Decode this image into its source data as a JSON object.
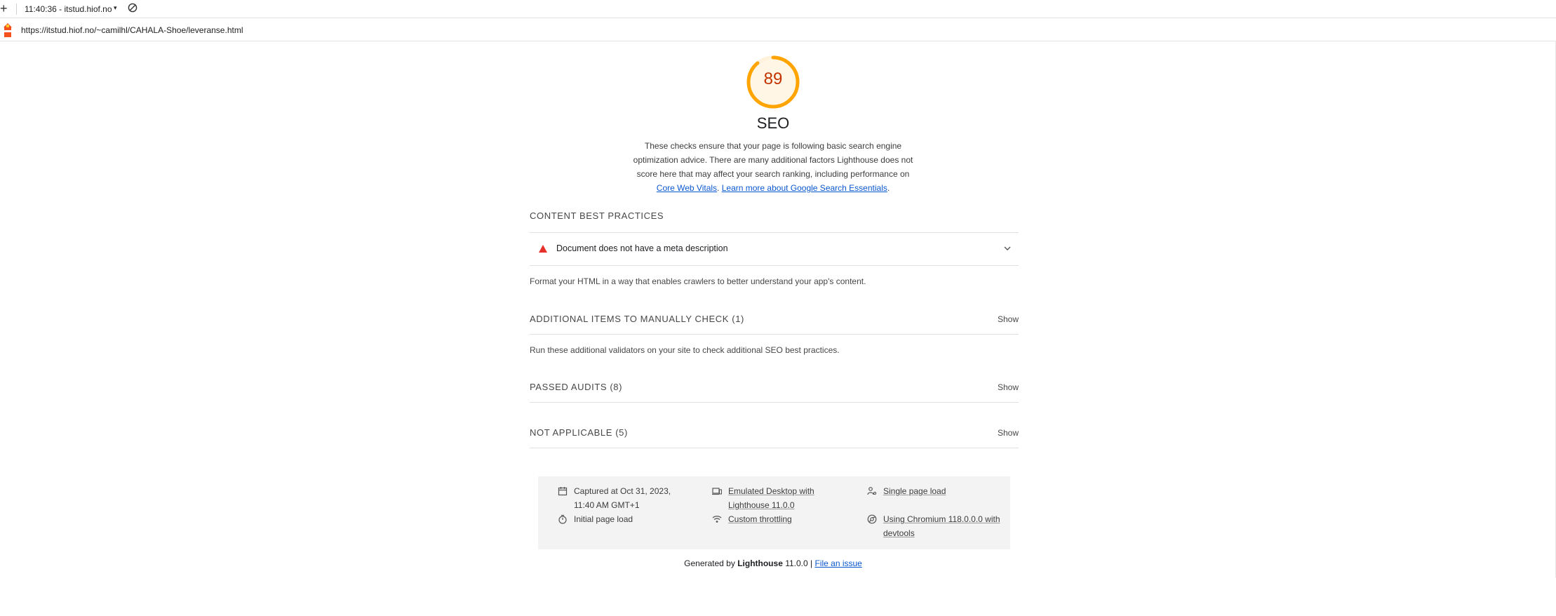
{
  "topbar": {
    "new_tab_symbol": "+",
    "session_label": "11:40:36 - itstud.hiof.no",
    "caret": "▾"
  },
  "address": {
    "url": "https://itstud.hiof.no/~camilhl/CAHALA-Shoe/leveranse.html"
  },
  "score": {
    "value": "89",
    "fraction": 0.89,
    "color": "#ffa400",
    "text_color": "#c33300"
  },
  "category": {
    "title": "SEO",
    "description_line1": "These checks ensure that your page is following basic search engine",
    "description_line2": "optimization advice. There are many additional factors Lighthouse does not",
    "description_line3": "score here that may affect your search ranking, including performance on",
    "link1": "Core Web Vitals",
    "sep": ". ",
    "link2": "Learn more about Google Search Essentials",
    "end": "."
  },
  "sections": {
    "content": {
      "title": "CONTENT BEST PRACTICES",
      "audit": "Document does not have a meta description",
      "description": "Format your HTML in a way that enables crawlers to better understand your app's content."
    },
    "manual": {
      "title": "ADDITIONAL ITEMS TO MANUALLY CHECK",
      "count": "(1)",
      "show": "Show",
      "description": "Run these additional validators on your site to check additional SEO best practices."
    },
    "passed": {
      "title": "PASSED AUDITS",
      "count": "(8)",
      "show": "Show"
    },
    "not_applicable": {
      "title": "NOT APPLICABLE",
      "count": "(5)",
      "show": "Show"
    }
  },
  "meta": {
    "captured_line1": "Captured at Oct 31, 2023,",
    "captured_line2": "11:40 AM GMT+1",
    "emulated_line1": "Emulated Desktop with",
    "emulated_line2": "Lighthouse 11.0.0",
    "single_page": "Single page load",
    "initial_load": "Initial page load",
    "throttling": "Custom throttling",
    "chromium_line1": "Using Chromium 118.0.0.0 with",
    "chromium_line2": "devtools"
  },
  "footer": {
    "generated_by": "Generated by ",
    "brand": "Lighthouse",
    "version": " 11.0.0 | ",
    "file_issue": "File an issue"
  }
}
